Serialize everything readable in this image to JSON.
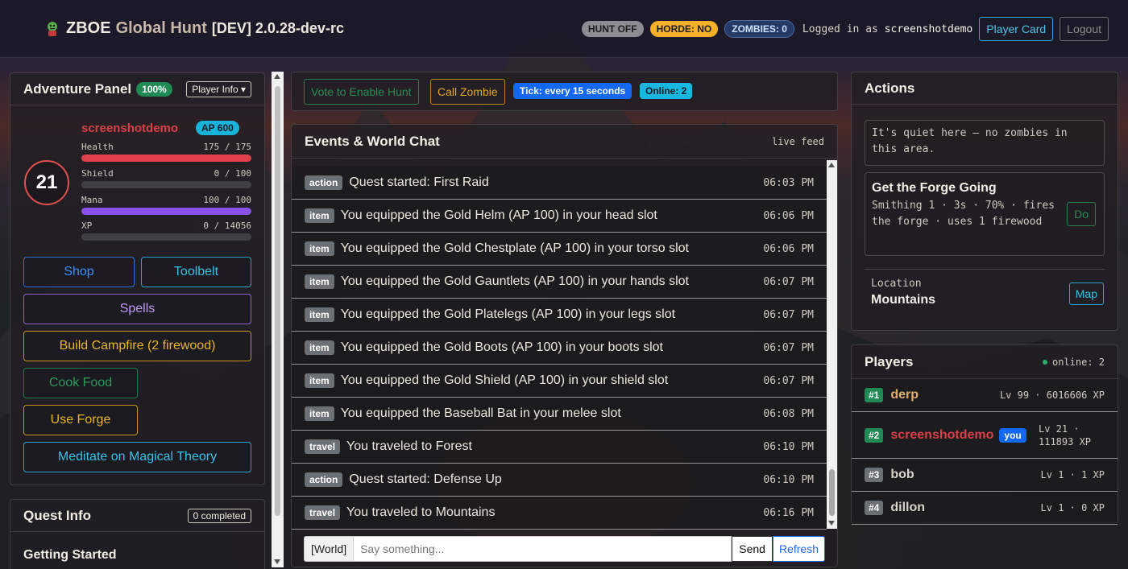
{
  "header": {
    "title_main": "ZBOE",
    "title_accent": "Global Hunt",
    "version": "[DEV] 2.0.28-dev-rc",
    "hunt_status": "HUNT OFF",
    "horde_status": "HORDE: NO",
    "zombies_status": "ZOMBIES: 0",
    "logged_in_prefix": "Logged in as",
    "username": "screenshotdemo",
    "player_card_label": "Player Card",
    "logout_label": "Logout",
    "icons": {
      "brand": "zombie-icon"
    }
  },
  "adventure": {
    "title": "Adventure Panel",
    "completion": "100%",
    "player_info_label": "Player Info",
    "player_name": "screenshotdemo",
    "ap": "AP 600",
    "level": "21",
    "stats": [
      {
        "label": "Health",
        "value": "175 / 175",
        "fraction": 1.0,
        "color": "#e0414c"
      },
      {
        "label": "Shield",
        "value": "0 / 100",
        "fraction": 0.0,
        "color": "#7a7f86"
      },
      {
        "label": "Mana",
        "value": "100 / 100",
        "fraction": 1.0,
        "color": "#8a52ea"
      },
      {
        "label": "XP",
        "value": "0 / 14056",
        "fraction": 0.0,
        "color": "#3a8ff5"
      }
    ],
    "buttons": {
      "shop": "Shop",
      "toolbelt": "Toolbelt",
      "spells": "Spells",
      "campfire": "Build Campfire (2 firewood)",
      "cook": "Cook Food",
      "forge": "Use Forge",
      "meditate": "Meditate on Magical Theory"
    }
  },
  "quest": {
    "title": "Quest Info",
    "completed": "0 completed",
    "subtitle": "Getting Started"
  },
  "controls": {
    "vote": "Vote to Enable Hunt",
    "call_zombie": "Call Zombie",
    "tick": "Tick: every 15 seconds",
    "online": "Online: 2"
  },
  "events": {
    "title": "Events & World Chat",
    "live": "live feed",
    "items": [
      {
        "tag": "action",
        "text": "Quest started: First Raid",
        "time": "06:03 PM"
      },
      {
        "tag": "item",
        "text": "You equipped the Gold Helm (AP 100) in your head slot",
        "time": "06:06 PM"
      },
      {
        "tag": "item",
        "text": "You equipped the Gold Chestplate (AP 100) in your torso slot",
        "time": "06:06 PM"
      },
      {
        "tag": "item",
        "text": "You equipped the Gold Gauntlets (AP 100) in your hands slot",
        "time": "06:07 PM"
      },
      {
        "tag": "item",
        "text": "You equipped the Gold Platelegs (AP 100) in your legs slot",
        "time": "06:07 PM"
      },
      {
        "tag": "item",
        "text": "You equipped the Gold Boots (AP 100) in your boots slot",
        "time": "06:07 PM"
      },
      {
        "tag": "item",
        "text": "You equipped the Gold Shield (AP 100) in your shield slot",
        "time": "06:07 PM"
      },
      {
        "tag": "item",
        "text": "You equipped the Baseball Bat in your melee slot",
        "time": "06:08 PM"
      },
      {
        "tag": "travel",
        "text": "You traveled to Forest",
        "time": "06:10 PM"
      },
      {
        "tag": "action",
        "text": "Quest started: Defense Up",
        "time": "06:10 PM"
      },
      {
        "tag": "travel",
        "text": "You traveled to Mountains",
        "time": "06:16 PM"
      }
    ]
  },
  "chat": {
    "channel": "[World]",
    "placeholder": "Say something...",
    "send": "Send",
    "refresh": "Refresh"
  },
  "actions": {
    "title": "Actions",
    "quiet": "It's quiet here — no zombies in this area.",
    "forge_title": "Get the Forge Going",
    "forge_desc": "Smithing 1 · 3s · 70% · fires the forge · uses 1 firewood",
    "do_label": "Do",
    "location_label": "Location",
    "location_value": "Mountains",
    "map_label": "Map"
  },
  "players": {
    "title": "Players",
    "online": "online: 2",
    "you_label": "you",
    "list": [
      {
        "rank": "#1",
        "name": "derp",
        "info": "Lv 99 · 6016606 XP",
        "name_color": "#e0b070"
      },
      {
        "rank": "#2",
        "name": "screenshotdemo",
        "info": "Lv 21 · 111893 XP",
        "name_color": "#d9404a"
      },
      {
        "rank": "#3",
        "name": "bob",
        "info": "Lv 1 · 1 XP",
        "name_color": "#d8d3cc"
      },
      {
        "rank": "#4",
        "name": "dillon",
        "info": "Lv 1 · 0 XP",
        "name_color": "#d8d3cc"
      }
    ]
  }
}
